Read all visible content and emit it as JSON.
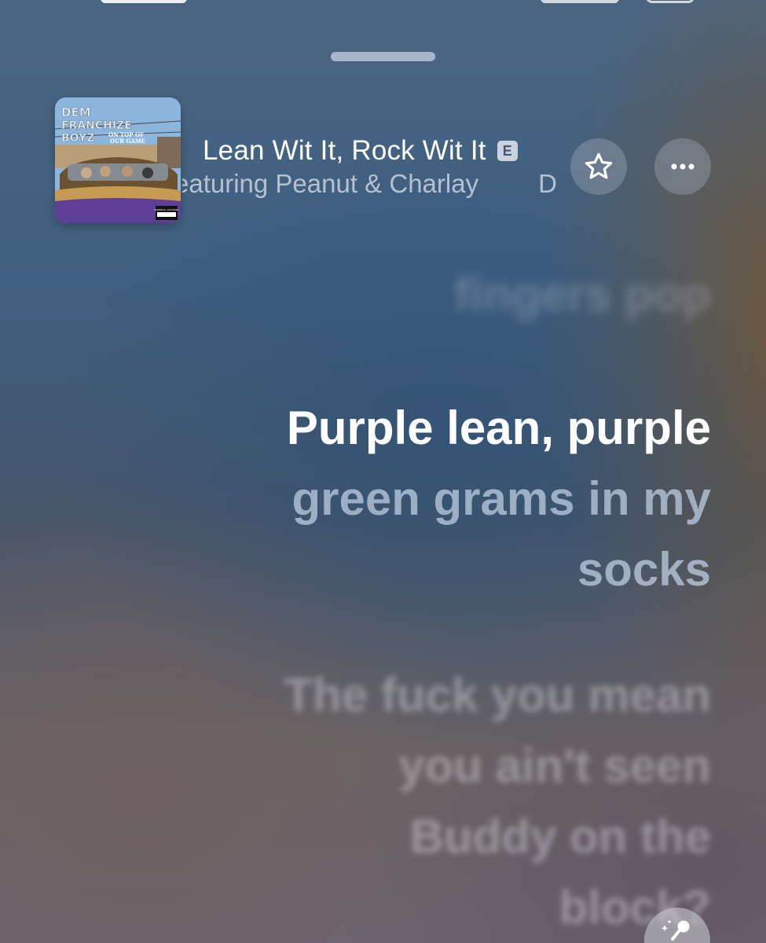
{
  "now_playing": {
    "title": "Lean Wit It, Rock Wit It",
    "explicit_badge": "E",
    "artist_visible_text": "eaturing Peanut & Charlay",
    "artist_trailing_char": "D",
    "artwork": {
      "text_line_1": "DEM",
      "text_line_2": "FRANCHIZE",
      "text_line_3": "BOYZ",
      "subtitle_line_1": "ON TOP OF",
      "subtitle_line_2": "OUR GAME",
      "advisory_label": "PARENTAL ADVISORY"
    }
  },
  "icons": {
    "favorite": "star-icon",
    "more": "ellipsis-icon",
    "sing": "microphone-sparkle-icon"
  },
  "lyrics": {
    "previous": "fingers pop",
    "current_sung": "Purple lean, purple",
    "current_upcoming_1": "green grams in my",
    "current_upcoming_2": "socks",
    "next_1": "The fuck you mean",
    "next_2": "you ain't seen",
    "next_3": "Buddy on the",
    "next_4": "block?"
  },
  "colors": {
    "lyric_active": "#ffffff",
    "lyric_upcoming": "#bccde1",
    "explicit_badge_bg": "#e1e6ee"
  }
}
